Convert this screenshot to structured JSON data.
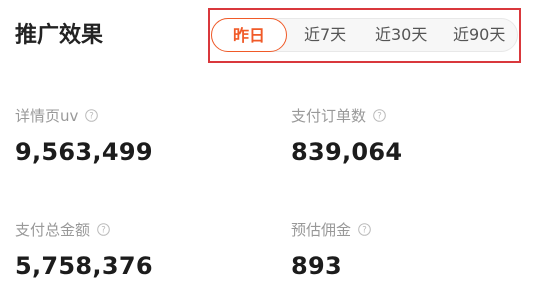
{
  "header": {
    "title": "推广效果"
  },
  "tabs": [
    {
      "label": "昨日",
      "active": true
    },
    {
      "label": "近7天",
      "active": false
    },
    {
      "label": "近30天",
      "active": false
    },
    {
      "label": "近90天",
      "active": false
    }
  ],
  "metrics": [
    {
      "label": "详情页uv",
      "value": "9,563,499",
      "icon": "help-icon"
    },
    {
      "label": "支付订单数",
      "value": "839,064",
      "icon": "help-icon"
    },
    {
      "label": "支付总金额",
      "value": "5,758,376",
      "icon": "help-icon"
    },
    {
      "label": "预估佣金",
      "value": "893",
      "icon": "help-icon"
    }
  ],
  "colors": {
    "accent": "#f05a28",
    "highlight_border": "#d9383c",
    "label": "#999999",
    "value": "#1c1c1c"
  }
}
